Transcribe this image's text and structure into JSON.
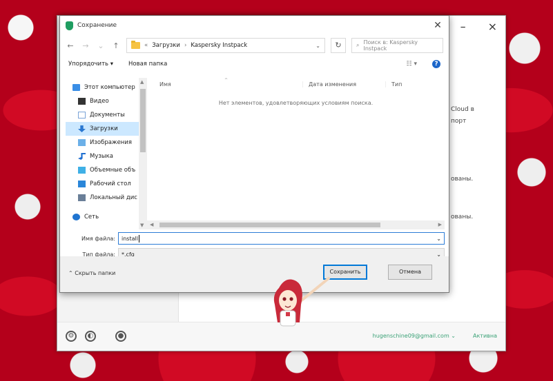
{
  "background_app": {
    "text_cloud": "Cloud в",
    "text_port": "порт",
    "text_mini1": "ованы.",
    "text_mini2": "ованы.",
    "footer_email": "hugenschine09@gmail.com ⌄",
    "footer_action": "Активна"
  },
  "dialog": {
    "title": "Сохранение",
    "close_glyph": "✕",
    "address": {
      "crumbs": [
        "Загрузки",
        "Kaspersky Instpack"
      ],
      "separator": "›",
      "prefix": "«"
    },
    "search_placeholder": "Поиск в: Kaspersky Instpack",
    "toolbar": {
      "organize_label": "Упорядочить ▾",
      "new_folder_label": "Новая папка",
      "view_label": "☷ ▾",
      "help_glyph": "?"
    },
    "nav_items": [
      {
        "label": "Этот компьютер",
        "icon": "pc"
      },
      {
        "label": "Видео",
        "icon": "video"
      },
      {
        "label": "Документы",
        "icon": "docs"
      },
      {
        "label": "Загрузки",
        "icon": "downloads"
      },
      {
        "label": "Изображения",
        "icon": "images"
      },
      {
        "label": "Музыка",
        "icon": "music"
      },
      {
        "label": "Объемные объ",
        "icon": "objects"
      },
      {
        "label": "Рабочий стол",
        "icon": "desktop"
      },
      {
        "label": "Локальный дис",
        "icon": "disk"
      },
      {
        "label": "Сеть",
        "icon": "network"
      }
    ],
    "selected_nav_index": 3,
    "columns": {
      "name": "Имя",
      "date": "Дата изменения",
      "type": "Тип"
    },
    "empty_message": "Нет элементов, удовлетворяющих условиям поиска.",
    "filename_label": "Имя файла:",
    "filename_value": "install",
    "filetype_label": "Тип файла:",
    "filetype_value": "*.cfg",
    "hide_folders_label": "⌃ Скрыть папки",
    "save_label": "Сохранить",
    "cancel_label": "Отмена"
  }
}
